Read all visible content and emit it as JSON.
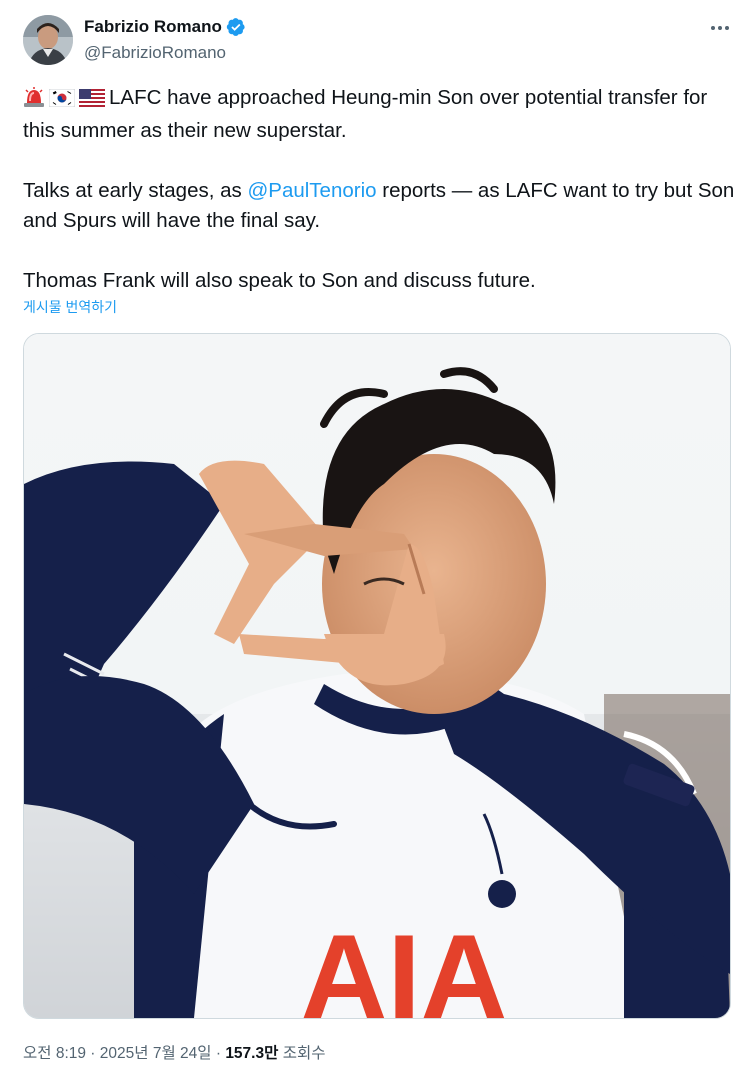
{
  "author": {
    "name": "Fabrizio Romano",
    "handle": "@FabrizioRomano"
  },
  "icons": {
    "verified": "verified-badge-icon",
    "more": "more-dots-icon",
    "siren": "siren-emoji",
    "flag_kr": "south-korea-flag-emoji",
    "flag_us": "usa-flag-emoji"
  },
  "tweet": {
    "line1_text": "LAFC have approached Heung-min Son over potential transfer for this summer as their new superstar.",
    "line2_pre": "Talks at early stages, as ",
    "line2_mention": "@PaulTenorio",
    "line2_post": " reports — as LAFC want to try but Son and Spurs will have the final say.",
    "line3": "Thomas Frank will also speak to Son and discuss future."
  },
  "translate_label": "게시물 번역하기",
  "shirt_sponsor": "AIA",
  "timestamp": {
    "time": "오전 8:19",
    "separator": " · ",
    "date": "2025년 7월 24일",
    "views_count": "157.3만",
    "views_label": "조회수"
  },
  "colors": {
    "accent": "#1d9bf0",
    "text": "#0f1419",
    "secondary": "#536471",
    "border": "#cfd9de",
    "jersey_navy": "#15204a",
    "sponsor_red": "#e4412b"
  }
}
